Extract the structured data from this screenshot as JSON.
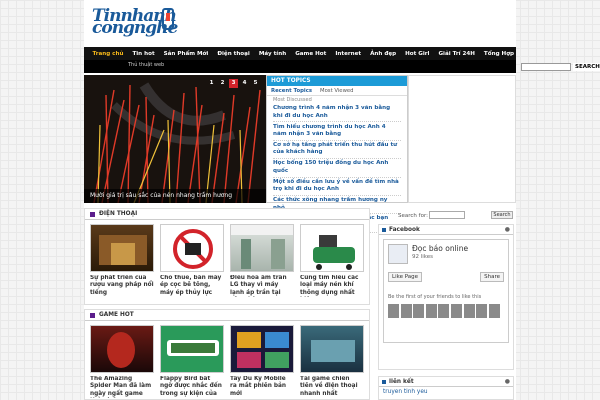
{
  "site": {
    "logo_line1": "Tinnhanh",
    "logo_line2": "congnghe"
  },
  "nav": [
    "Trang chủ",
    "Tin hot",
    "Sản Phẩm Mới",
    "Điện thoại",
    "Máy tính",
    "Game Hot",
    "Internet",
    "Ảnh đẹp",
    "Hot Girl",
    "Giải Trí 24H",
    "Tổng Hợp"
  ],
  "subnav": {
    "item": "Thủ thuật web",
    "search_button": "SEARCH"
  },
  "slider": {
    "caption": "Mười giá trị sâu sắc của nén nhang trầm hương",
    "pages": [
      "1",
      "2",
      "3",
      "4",
      "5"
    ],
    "active_page": "3"
  },
  "hot": {
    "title": "HOT TOPICS",
    "tab_recent": "Recent Topics",
    "tab_viewed": "Most Viewed",
    "sub": "Most Discussed",
    "items": [
      "Chương trình 4 năm nhận 3 văn bằng khi đi du học Anh",
      "Tìm hiểu chương trình du học Anh 4 năm nhận 3 văn bằng",
      "Cơ sở hạ tầng phát triển thu hút đầu tư của khách hàng",
      "Học bổng 150 triệu đồng du học Anh quốc",
      "Một số điều cần lưu ý về vấn đề tìm nhà trọ khi đi du học Anh",
      "Các thức xông nhang trầm hương ny nhỏ",
      "Tư vấn du học Anh dành cho các bạn học hết"
    ]
  },
  "section_phone": {
    "title": "ĐIỆN THOẠI",
    "items": [
      "Sự phát triển của rượu vang pháp nổi tiếng",
      "Cho thuê, bán máy ép cọc bê tông, máy ép thủy lực",
      "Điều hòa âm trần LG thay vì máy lạnh áp trần tại văn phòng",
      "Cùng tìm hiểu các loại máy nén khí thông dụng nhất hiện nay"
    ]
  },
  "section_game": {
    "title": "GAME HOT",
    "items": [
      "The Amazing Spider Man đã làm ngày ngất game thủ và fan",
      "Flappy Bird bất ngờ được nhắc đến trong sự kiện của",
      "Tây Du Ký Mobile ra mắt phiên bản mới",
      "Tải game chiến tiên về điện thoại nhanh nhất"
    ]
  },
  "sidebar": {
    "search_label": "Search for:",
    "search_button": "Search",
    "facebook_title": "Facebook",
    "page_name": "Đọc báo online",
    "likes": "92 likes",
    "like_button": "Like Page",
    "share_button": "Share",
    "friends_text": "Be the first of your friends to like this",
    "links_title": "liên kết",
    "link1": "truyen tinh yeu"
  }
}
